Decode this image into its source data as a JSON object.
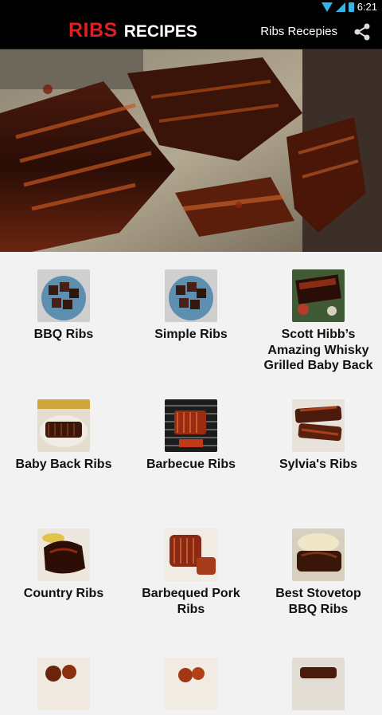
{
  "status": {
    "time": "6:21",
    "wifi_icon": "wifi-icon",
    "signal_icon": "signal-icon",
    "battery_icon": "battery-icon"
  },
  "header": {
    "title_part1": "RIBS",
    "title_part2": "RECIPES",
    "subtitle": "Ribs Recepies",
    "share_icon": "share-icon"
  },
  "recipes": [
    {
      "label": "BBQ Ribs"
    },
    {
      "label": "Simple  Ribs"
    },
    {
      "label": "Scott Hibb’s Amazing Whisky Grilled Baby Back"
    },
    {
      "label": "Baby Back Ribs"
    },
    {
      "label": "Barbecue Ribs"
    },
    {
      "label": "Sylvia's Ribs"
    },
    {
      "label": "Country Ribs"
    },
    {
      "label": "Barbequed Pork Ribs"
    },
    {
      "label": "Best Stovetop BBQ Ribs"
    },
    {
      "label": ""
    },
    {
      "label": ""
    },
    {
      "label": ""
    }
  ],
  "colors": {
    "accent_red": "#e02020",
    "status_blue": "#35b5e5",
    "background": "#f2f2f2"
  }
}
